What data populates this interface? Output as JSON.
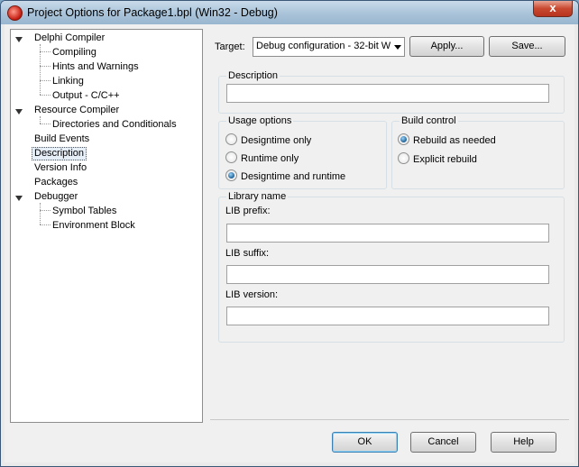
{
  "window": {
    "title": "Project Options for Package1.bpl  (Win32 - Debug)",
    "close_label": "x"
  },
  "tree": {
    "items": [
      {
        "label": "Delphi Compiler"
      },
      {
        "label": "Compiling"
      },
      {
        "label": "Hints and Warnings"
      },
      {
        "label": "Linking"
      },
      {
        "label": "Output - C/C++"
      },
      {
        "label": "Resource Compiler"
      },
      {
        "label": "Directories and Conditionals"
      },
      {
        "label": "Build Events"
      },
      {
        "label": "Description",
        "selected": true
      },
      {
        "label": "Version Info"
      },
      {
        "label": "Packages"
      },
      {
        "label": "Debugger"
      },
      {
        "label": "Symbol Tables"
      },
      {
        "label": "Environment Block"
      }
    ]
  },
  "target": {
    "label": "Target:",
    "value": "Debug configuration - 32-bit W",
    "apply_label": "Apply...",
    "save_label": "Save..."
  },
  "description": {
    "group_title": "Description",
    "value": ""
  },
  "usage_options": {
    "group_title": "Usage options",
    "options": [
      {
        "label": "Designtime only",
        "checked": false
      },
      {
        "label": "Runtime only",
        "checked": false
      },
      {
        "label": "Designtime and runtime",
        "checked": true
      }
    ]
  },
  "build_control": {
    "group_title": "Build control",
    "options": [
      {
        "label": "Rebuild as needed",
        "checked": true
      },
      {
        "label": "Explicit rebuild",
        "checked": false
      }
    ]
  },
  "library_name": {
    "group_title": "Library name",
    "lib_prefix_label": "LIB prefix:",
    "lib_prefix_value": "",
    "lib_suffix_label": "LIB suffix:",
    "lib_suffix_value": "",
    "lib_version_label": "LIB version:",
    "lib_version_value": ""
  },
  "footer": {
    "ok_label": "OK",
    "cancel_label": "Cancel",
    "help_label": "Help"
  },
  "colors": {
    "titlebar": "#a9c3d9",
    "dialog_bg": "#f0f0f0",
    "selection_bg": "#e6eef8",
    "close_button": "#c9482f"
  }
}
